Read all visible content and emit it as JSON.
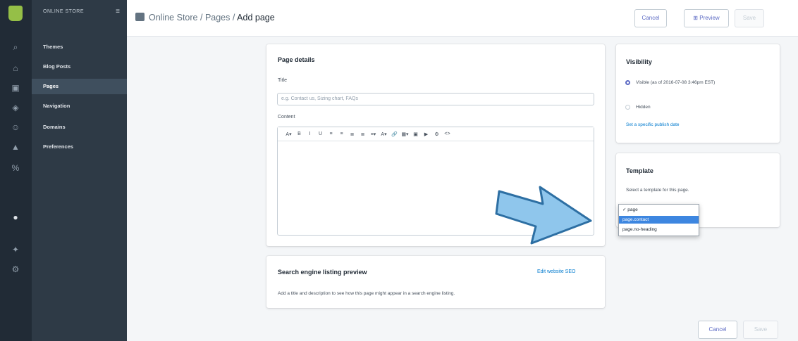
{
  "store_nav": {
    "title": "ONLINE STORE",
    "items": [
      {
        "label": "Themes"
      },
      {
        "label": "Blog Posts"
      },
      {
        "label": "Pages"
      },
      {
        "label": "Navigation"
      },
      {
        "label": "Domains"
      },
      {
        "label": "Preferences"
      }
    ]
  },
  "header": {
    "breadcrumb_parent": "Online Store",
    "breadcrumb_section": "Pages",
    "breadcrumb_current": "Add page",
    "sep": "/",
    "cancel_label": "Cancel",
    "preview_label": "Preview",
    "save_label": "Save"
  },
  "page_details": {
    "heading": "Page details",
    "title_label": "Title",
    "title_placeholder": "e.g. Contact us, Sizing chart, FAQs",
    "content_label": "Content",
    "toolbar": [
      "A▾",
      "B",
      "I",
      "U",
      "≡",
      "≡",
      "≣",
      "≣",
      "≡▾",
      "A▾",
      "🔗",
      "▦▾",
      "▣",
      "▶",
      "⚙",
      "<>"
    ]
  },
  "seo": {
    "heading": "Search engine listing preview",
    "edit_link": "Edit website SEO",
    "description": "Add a title and description to see how this page might appear in a search engine listing."
  },
  "visibility": {
    "heading": "Visibility",
    "visible_label": "Visible (as of 2016-07-08 3:46pm EST)",
    "hidden_label": "Hidden",
    "publish_link": "Set a specific publish date"
  },
  "template": {
    "heading": "Template",
    "description": "Select a template for this page.",
    "options": [
      {
        "label": "✓ page"
      },
      {
        "label": "page.contact"
      },
      {
        "label": "page.no-heading"
      }
    ],
    "selected_index": 1
  },
  "footer": {
    "cancel_label": "Cancel",
    "save_label": "Save"
  },
  "colors": {
    "accent": "#5c6ac4",
    "link": "#007ace",
    "arrow_fill": "#8fc6ec",
    "arrow_stroke": "#2d6fa3"
  }
}
